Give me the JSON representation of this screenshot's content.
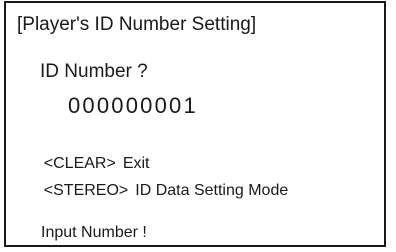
{
  "screen": {
    "title": "[Player's ID Number Setting]",
    "prompt": "ID Number ?",
    "id_value": "000000001",
    "key_actions": [
      {
        "key": "<CLEAR>",
        "action": "Exit"
      },
      {
        "key": "<STEREO>",
        "action": "ID Data Setting Mode"
      }
    ],
    "status": "Input Number !"
  }
}
